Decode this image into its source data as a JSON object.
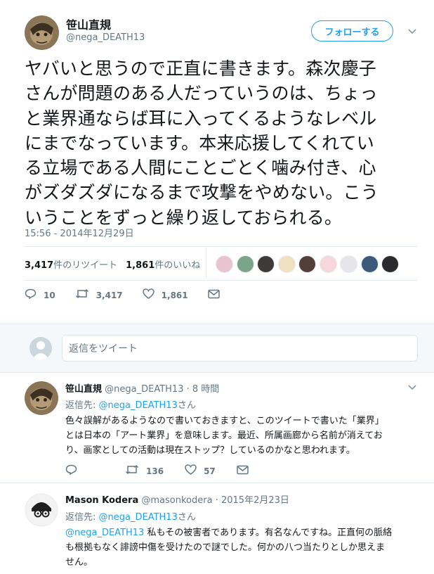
{
  "tweet": {
    "author_name": "笹山直規",
    "author_handle": "@nega_DEATH13",
    "follow_label": "フォローする",
    "text_lines": [
      "ヤバいと思うので正直に書きます。森次慶子",
      "さんが問題のある人だっていうのは、ちょっ",
      "と業界通ならば耳に入ってくるようなレベル",
      "にまでなっています。本来応援してくれてい",
      "る立場である人間にことごとく噛み付き、心",
      "がズダズダになるまで攻撃をやめない。こう",
      "いうことをずっと繰り返しておられる。"
    ],
    "timestamp": "15:56 - 2014年12月29日",
    "retweet_count": "3,417",
    "retweet_label": "件のリツイート",
    "like_count": "1,861",
    "like_label": "件のいいね",
    "actions": {
      "reply_count": "10",
      "retweet_count": "3,417",
      "like_count": "1,861"
    }
  },
  "likers_colors": [
    "#e9c4d0",
    "#7aa58a",
    "#3d3a38",
    "#f0e2c0",
    "#51403a",
    "#f5d7dd",
    "#e6e6ea",
    "#3c5a7a",
    "#2b2a2c"
  ],
  "reply_box": {
    "placeholder": "返信をツイート"
  },
  "replies": [
    {
      "name": "笹山直規",
      "handle": "@nega_DEATH13",
      "time": "· 8 時間",
      "to_prefix": "返信先: ",
      "to_handle": "@nega_DEATH13",
      "to_suffix": "さん",
      "text_lines": [
        "色々誤解があるようなので書いておきますと、このツイートで書いた「業界」",
        "とは日本の「アート業界」を意味します。最近、所属画廊から名前が消えてお",
        "り、画家としての活動は現在ストップ？しているのかなと思われます。"
      ],
      "actions": {
        "reply_count": "",
        "retweet_count": "136",
        "like_count": "57"
      }
    },
    {
      "name": "Mason Kodera",
      "handle": "@masonkodera",
      "time": "· 2015年2月23日",
      "to_prefix": "返信先: ",
      "to_handle": "@nega_DEATH13",
      "to_suffix": "さん",
      "mention": "@nega_DEATH13",
      "text_first_rest": " 私もその被害者であります。有名なんですね。正直何の脈絡",
      "text_lines_rest": [
        "も根拠もなく誹謗中傷を受けたので謎でした。何かの八つ当たりとしか思えま",
        "せん。"
      ]
    }
  ],
  "icons": {
    "reply": "reply-icon",
    "retweet": "retweet-icon",
    "like": "heart-icon",
    "dm": "envelope-icon",
    "caret": "chevron-down-icon"
  }
}
